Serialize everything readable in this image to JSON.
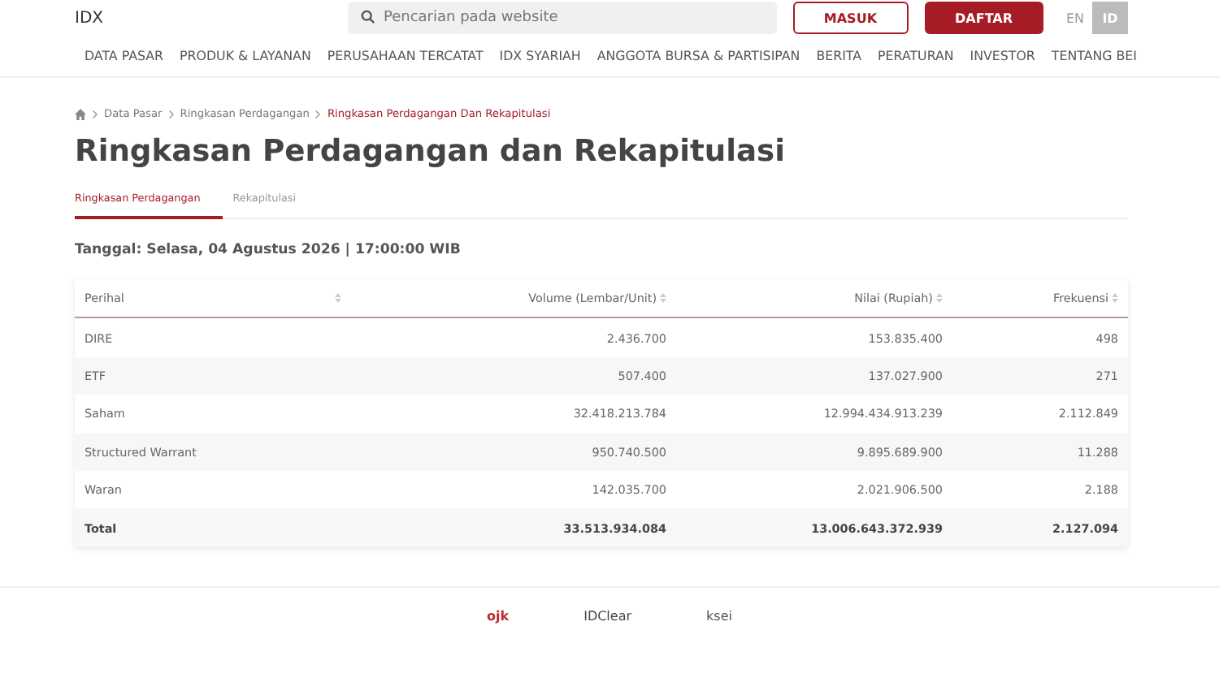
{
  "header": {
    "logo": "IDX",
    "search": {
      "placeholder": "Pencarian pada website"
    },
    "buttons": [
      {
        "label": "MASUK",
        "kind": "outline"
      },
      {
        "label": "DAFTAR",
        "kind": "solid"
      }
    ],
    "languages": [
      {
        "label": "EN",
        "selected": false
      },
      {
        "label": "ID",
        "selected": true
      }
    ]
  },
  "nav": [
    "DATA PASAR",
    "PRODUK & LAYANAN",
    "PERUSAHAAN TERCATAT",
    "IDX SYARIAH",
    "ANGGOTA BURSA & PARTISIPAN",
    "BERITA",
    "PERATURAN",
    "INVESTOR",
    "TENTANG BEI"
  ],
  "breadcrumb": [
    "Data Pasar",
    "Ringkasan Perdagangan",
    "Ringkasan Perdagangan Dan Rekapitulasi"
  ],
  "title": "Ringkasan Perdagangan dan Rekapitulasi",
  "tabs": [
    {
      "label": "Ringkasan Perdagangan",
      "selected": true
    },
    {
      "label": "Rekapitulasi",
      "selected": false
    }
  ],
  "date": "Tanggal: Selasa, 04 Agustus 2026 | 17:00:00 WIB",
  "table": {
    "columns": [
      "Perihal",
      "Volume (Lembar/Unit)",
      "Nilai (Rupiah)",
      "Frekuensi"
    ],
    "rows": [
      [
        "DIRE",
        "2.436.700",
        "153.835.400",
        "498"
      ],
      [
        "ETF",
        "507.400",
        "137.027.900",
        "271"
      ],
      [
        "Saham",
        "32.418.213.784",
        "12.994.434.913.239",
        "2.112.849"
      ],
      [
        "Structured Warrant",
        "950.740.500",
        "9.895.689.900",
        "11.288"
      ],
      [
        "Waran",
        "142.035.700",
        "2.021.906.500",
        "2.188"
      ]
    ],
    "total": [
      "Total",
      "33.513.934.084",
      "13.006.643.372.939",
      "2.127.094"
    ]
  },
  "footer_logos": [
    {
      "text": "ojk",
      "kind": "ojk"
    },
    {
      "text": "IDClear",
      "kind": "idclear"
    },
    {
      "text": "ksei",
      "kind": "ksei"
    }
  ]
}
